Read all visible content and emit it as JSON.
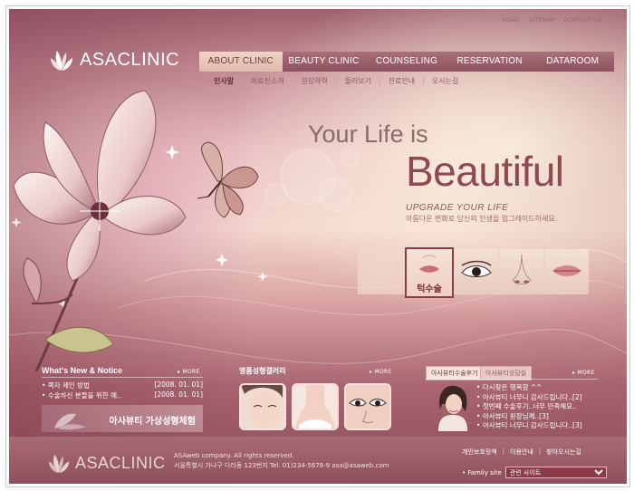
{
  "brand": {
    "name": "ASACLINIC"
  },
  "top_links": [
    "HOME",
    "SITEMAP",
    "CONTACT US"
  ],
  "gnb": [
    {
      "label": "ABOUT CLINIC",
      "active": true
    },
    {
      "label": "BEAUTY CLINIC",
      "active": false
    },
    {
      "label": "COUNSELING",
      "active": false
    },
    {
      "label": "RESERVATION",
      "active": false
    },
    {
      "label": "DATAROOM",
      "active": false
    }
  ],
  "submenu": [
    "인사말",
    "의료진소개",
    "원장약력",
    "둘러보기",
    "진료안내",
    "오시는길"
  ],
  "hero": {
    "line1": "Your Life is",
    "line2": "Beautiful",
    "upgrade": "UPGRADE YOUR LIFE",
    "upgrade_sub": "아름다운 변화로 당신의 인생을 업그레이드하세요."
  },
  "features": [
    {
      "label": "턱수술",
      "icon": "lips-icon"
    },
    {
      "label": "",
      "icon": "eye-icon"
    },
    {
      "label": "",
      "icon": "nose-icon"
    },
    {
      "label": "",
      "icon": "lips-icon"
    }
  ],
  "news": {
    "title": "What's New & Notice",
    "more": "MORE",
    "items": [
      {
        "text": "쪽자 제인 방법",
        "date": "[2008. 01. 01]"
      },
      {
        "text": "수술하신 분들을 위한 예..",
        "date": "[2008. 01. 01]"
      }
    ],
    "banner": "아사뷰티 가상성형체험"
  },
  "gallery": {
    "title": "명품성형갤러리",
    "more": "MORE"
  },
  "reviews": {
    "tabs": [
      "아사뷰티수술후기",
      "아사뷰티상담실"
    ],
    "more": "MORE",
    "items": [
      "다시찾은 행복함 ^^",
      "아사뷰티 너무니 감사드립니다..[2]",
      "첫번째 수술후기..너무 만족해요..",
      "아사뷰티 원장님께..[3]",
      "아사뷰티 너무니 감사드립니다..[3]"
    ]
  },
  "footer": {
    "company": "ASAweb company. All rights reserved.",
    "address": "서울특별시 가나구 다라동 123번지 Tel. 01)234-5678-9 asa@asaweb.com",
    "links": [
      "개인보호정책",
      "이용안내",
      "찾아오시는길"
    ],
    "family_label": "Family site",
    "family_value": "관련 사이트"
  },
  "colors": {
    "accent": "#8d4a54",
    "gnb": "#9a5f6b",
    "footer": "#9b5c69"
  }
}
